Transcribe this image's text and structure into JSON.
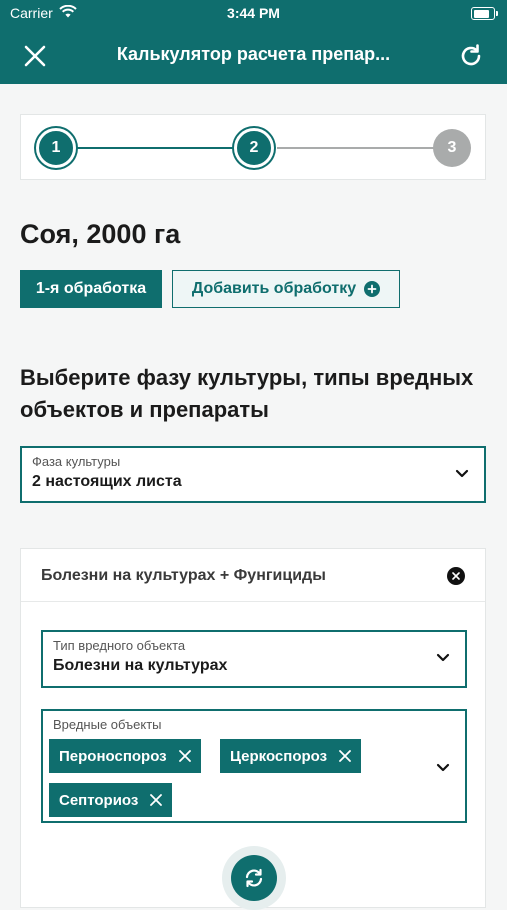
{
  "status": {
    "carrier": "Carrier",
    "time": "3:44 PM"
  },
  "header": {
    "title": "Калькулятор расчета препар..."
  },
  "stepper": {
    "steps": [
      "1",
      "2",
      "3"
    ]
  },
  "crop": {
    "title": "Соя, 2000 га"
  },
  "treatments": {
    "first_label": "1-я обработка",
    "add_label": "Добавить обработку"
  },
  "section": {
    "title": "Выберите фазу культуры, типы вредных объектов и препараты"
  },
  "phase": {
    "label": "Фаза культуры",
    "value": "2 настоящих листа"
  },
  "card": {
    "title": "Болезни на культурах + Фунгициды",
    "pest_type": {
      "label": "Тип вредного объекта",
      "value": "Болезни на культурах"
    },
    "pests": {
      "label": "Вредные объекты",
      "chips": [
        "Пероноспороз",
        "Церкоспороз",
        "Септориоз"
      ]
    }
  },
  "colors": {
    "brand": "#0f6e6e",
    "inactive_step": "#a9abab"
  },
  "icons": [
    "wifi-icon",
    "battery-icon",
    "close-icon",
    "refresh-icon",
    "plus-circle-icon",
    "chevron-down-icon",
    "remove-chip-icon"
  ]
}
